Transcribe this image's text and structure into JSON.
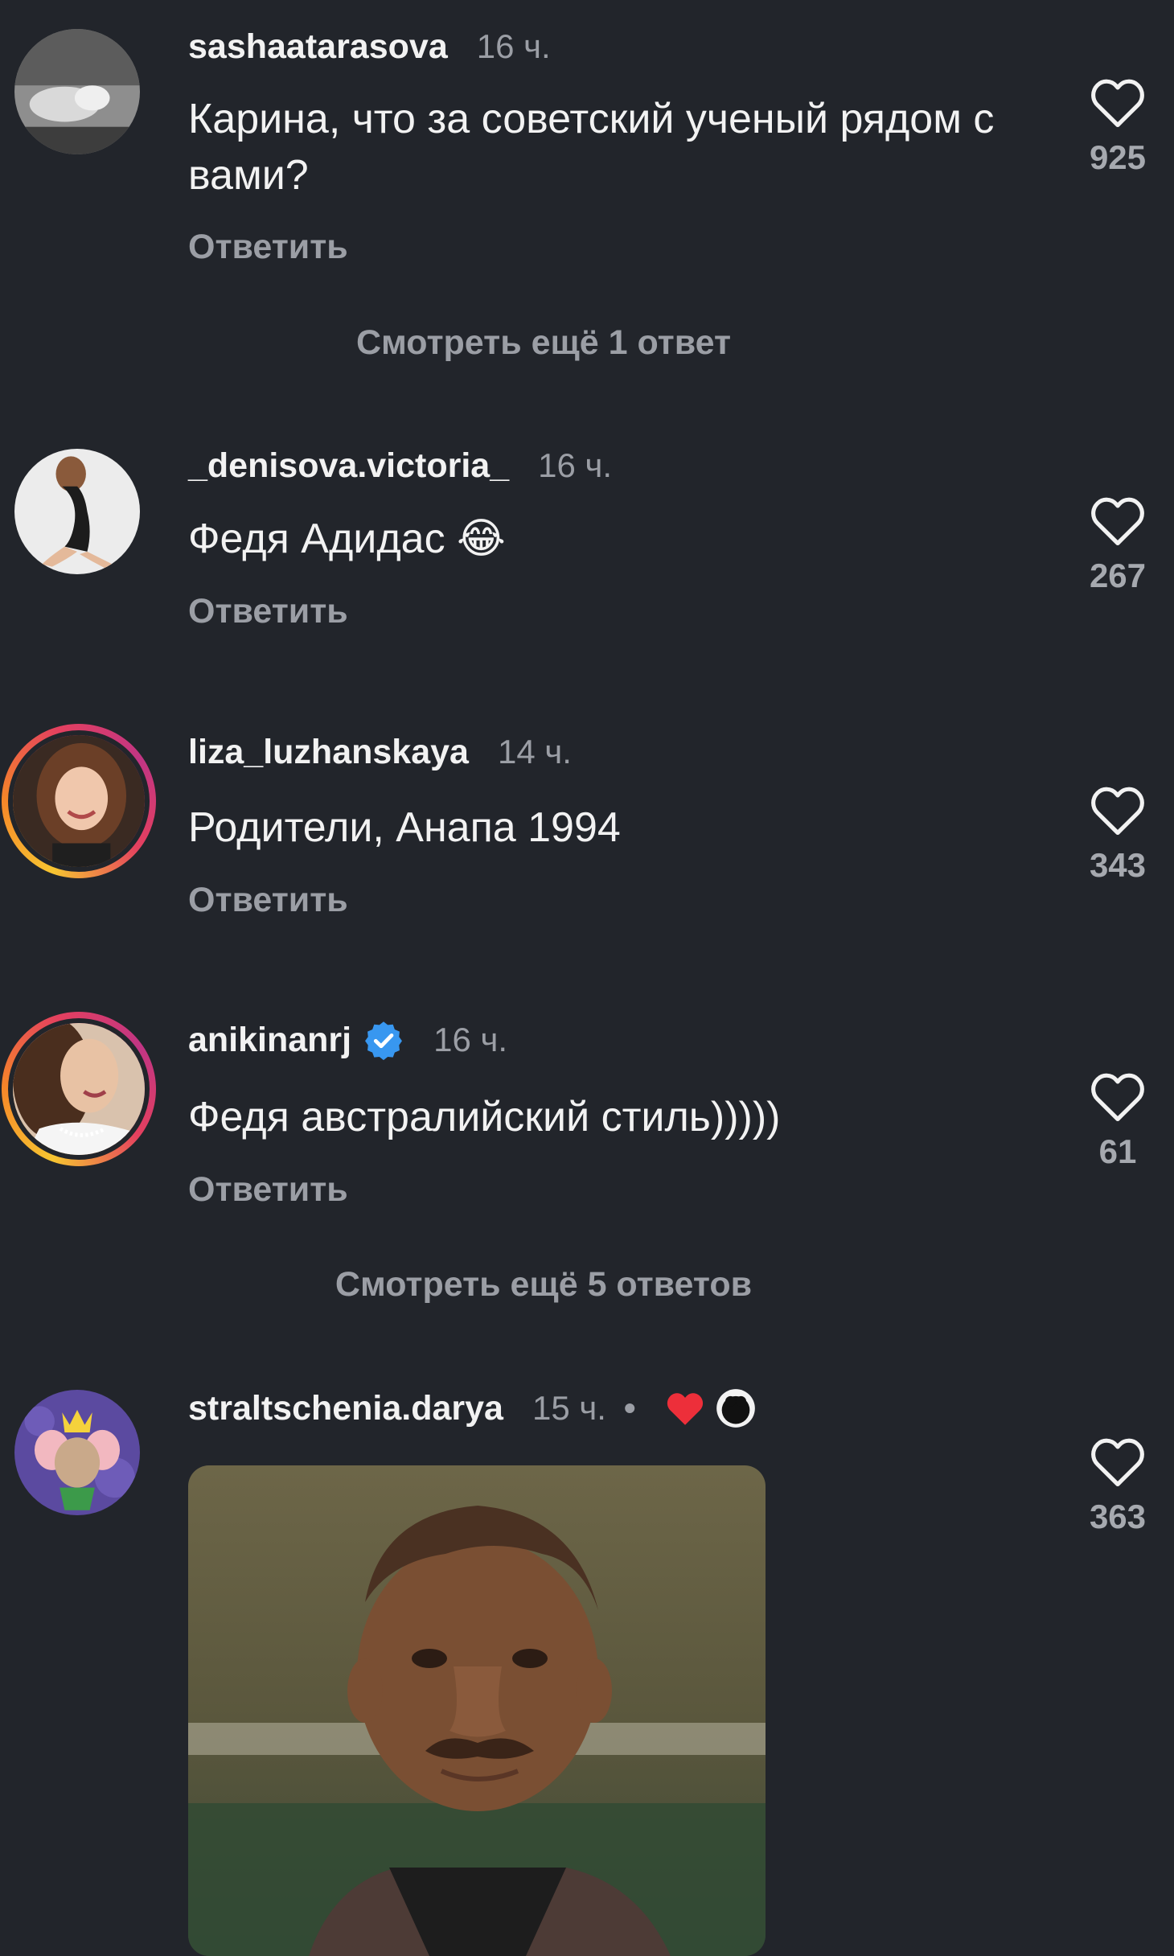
{
  "comments": [
    {
      "username": "sashaatarasova",
      "time": "16 ч.",
      "text": "Карина, что за советский ученый рядом с вами?",
      "reply_label": "Ответить",
      "likes": "925",
      "view_more": "Смотреть ещё 1 ответ"
    },
    {
      "username": "_denisova.victoria_",
      "time": "16 ч.",
      "text": "Федя Адидас 😂",
      "reply_label": "Ответить",
      "likes": "267"
    },
    {
      "username": "liza_luzhanskaya",
      "time": "14 ч.",
      "text": "Родители, Анапа 1994",
      "reply_label": "Ответить",
      "likes": "343"
    },
    {
      "username": "anikinanrj",
      "time": "16 ч.",
      "text": "Федя австралийский стиль)))))",
      "reply_label": "Ответить",
      "likes": "61",
      "view_more": "Смотреть ещё 5 ответов"
    },
    {
      "username": "straltschenia.darya",
      "time": "15 ч.",
      "separator": "•",
      "likes": "363"
    }
  ],
  "icons": {
    "like": "heart-outline-icon",
    "verified": "verified-badge-icon",
    "creator_liked": "red-heart-icon"
  },
  "colors": {
    "background": "#22252b",
    "text": "#f2f2f2",
    "muted": "#9b9ea5",
    "verified": "#3897f0",
    "heart": "#ed2f3a"
  }
}
